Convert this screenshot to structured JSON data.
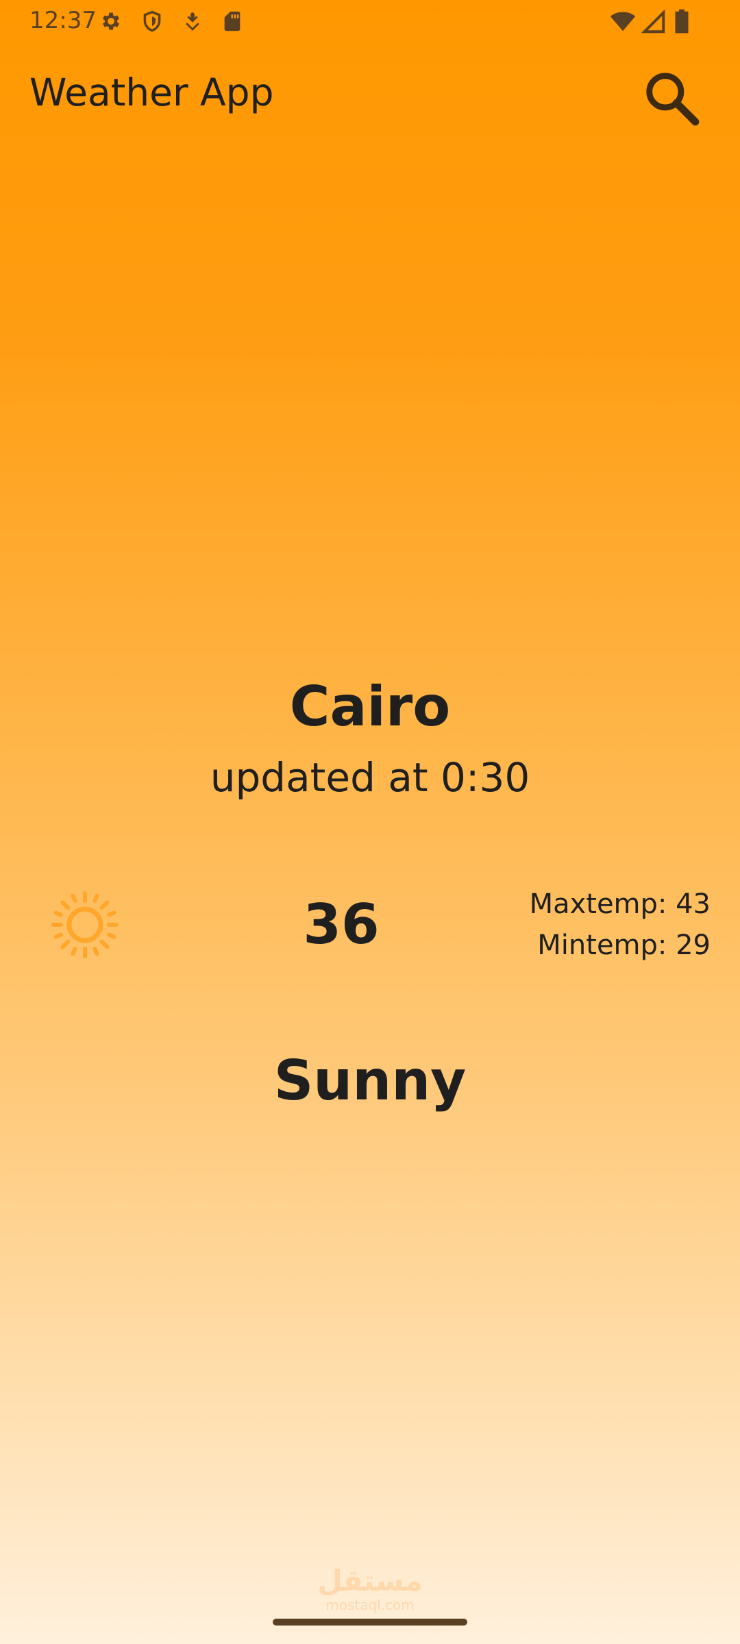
{
  "status_bar": {
    "time": "12:37",
    "icons_left": [
      "gear-icon",
      "shield-icon",
      "download-icon",
      "sd-card-icon"
    ],
    "icons_right": [
      "wifi-icon",
      "signal-icon",
      "battery-icon"
    ]
  },
  "app_bar": {
    "title": "Weather App",
    "search_icon": "search-icon"
  },
  "weather": {
    "city": "Cairo",
    "updated": "updated at 0:30",
    "icon": "sun-icon",
    "temp": "36",
    "max_temp": "Maxtemp: 43",
    "min_temp": "Mintemp: 29",
    "condition": "Sunny"
  },
  "watermark": {
    "main": "مستقل",
    "sub": "mostaql.com"
  },
  "colors": {
    "gradient_top": "#ff9800",
    "gradient_bottom": "#fff0dc",
    "text": "#1f1f1f",
    "sun": "#ffa62b"
  }
}
